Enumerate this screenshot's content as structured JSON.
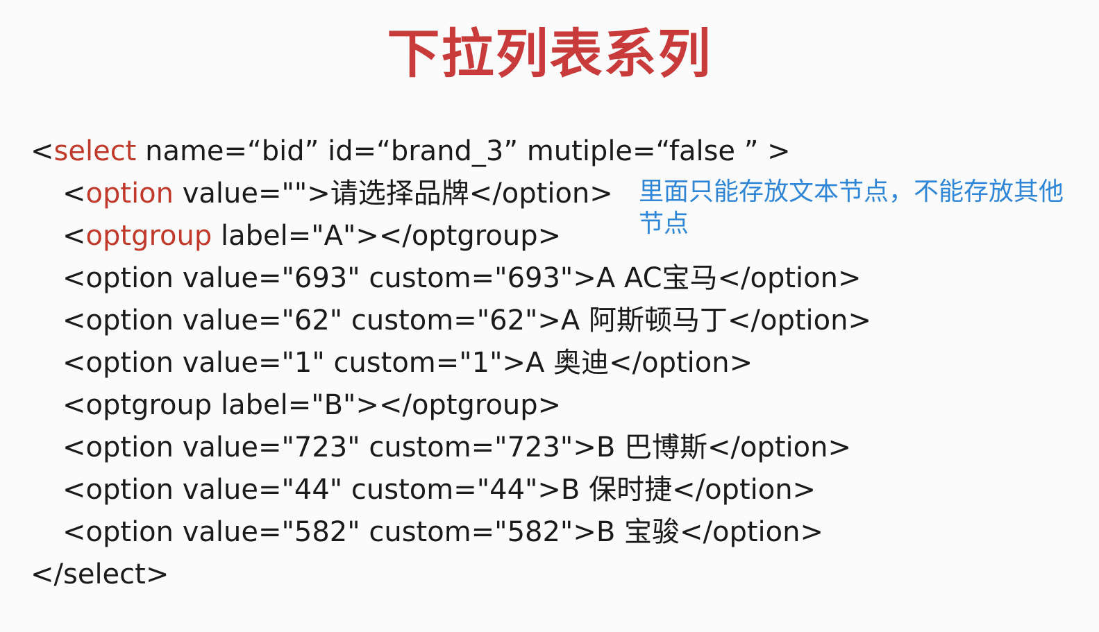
{
  "title": "下拉列表系列",
  "code": {
    "l1": {
      "open": "<",
      "tag": "select",
      "rest": " name=“bid” id=“brand_3” mutiple=“false ” >"
    },
    "l2": {
      "open": "<",
      "tag": "option",
      "rest": " value=\"\">请选择品牌</option>"
    },
    "l3": {
      "open": "<",
      "tag": "optgroup",
      "rest": " label=\"A\"></optgroup>"
    },
    "l4": "<option value=\"693\" custom=\"693\">A AC宝马</option>",
    "l5": "<option value=\"62\" custom=\"62\">A 阿斯顿马丁</option>",
    "l6": "<option value=\"1\" custom=\"1\">A 奥迪</option>",
    "l7": "<optgroup label=\"B\"></optgroup>",
    "l8": "<option value=\"723\" custom=\"723\">B 巴博斯</option>",
    "l9": "<option value=\"44\" custom=\"44\">B 保时捷</option>",
    "l10": "<option value=\"582\" custom=\"582\">B 宝骏</option>",
    "l11": "</select>"
  },
  "note": "里面只能存放文本节点，不能存放其他节点",
  "colors": {
    "title": "#c93a3a",
    "keyword": "#c0392b",
    "note": "#2f86d6"
  }
}
